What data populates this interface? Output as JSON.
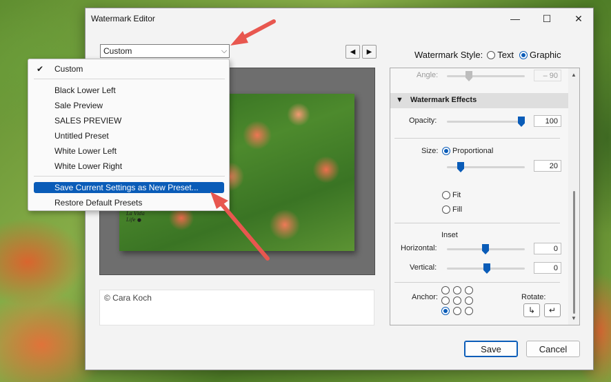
{
  "window": {
    "title": "Watermark Editor",
    "minimize_glyph": "—",
    "maximize_glyph": "☐",
    "close_glyph": "✕"
  },
  "preset": {
    "selected": "Custom",
    "chevron_glyph": "⌵"
  },
  "nav": {
    "prev_glyph": "◀",
    "next_glyph": "▶"
  },
  "preview": {
    "watermark_glyph_line1": "La Vida",
    "watermark_glyph_line2": "Life ●"
  },
  "copyright_text": "© Cara Koch",
  "style": {
    "label": "Watermark Style:",
    "text_option": "Text",
    "graphic_option": "Graphic",
    "selected": "Graphic"
  },
  "panel": {
    "angle_label": "Angle:",
    "angle_value": "– 90",
    "effects_header": "Watermark Effects",
    "effects_collapse_glyph": "▼",
    "opacity_label": "Opacity:",
    "opacity_value": "100",
    "opacity_level": 1.0,
    "size_label": "Size:",
    "size_proportional": "Proportional",
    "size_value": "20",
    "size_level": 0.15,
    "size_fit": "Fit",
    "size_fill": "Fill",
    "inset_label": "Inset",
    "horizontal_label": "Horizontal:",
    "horizontal_value": "0",
    "vertical_label": "Vertical:",
    "vertical_value": "0",
    "anchor_label": "Anchor:",
    "rotate_label": "Rotate:",
    "rotate_cw_glyph": "↳",
    "rotate_ccw_glyph": "↵",
    "scroll_up_glyph": "▲",
    "scroll_down_glyph": "▼"
  },
  "buttons": {
    "save": "Save",
    "cancel": "Cancel"
  },
  "menu": {
    "check_glyph": "✔",
    "items": [
      "Custom",
      "Black Lower Left",
      "Sale Preview",
      "SALES PREVIEW",
      "Untitled Preset",
      "White Lower Left",
      "White Lower Right",
      "Save Current Settings as New Preset...",
      "Restore Default Presets"
    ],
    "highlighted": "Save Current Settings as New Preset..."
  },
  "colors": {
    "accent": "#0a5cb8",
    "arrow": "#e8574f"
  }
}
